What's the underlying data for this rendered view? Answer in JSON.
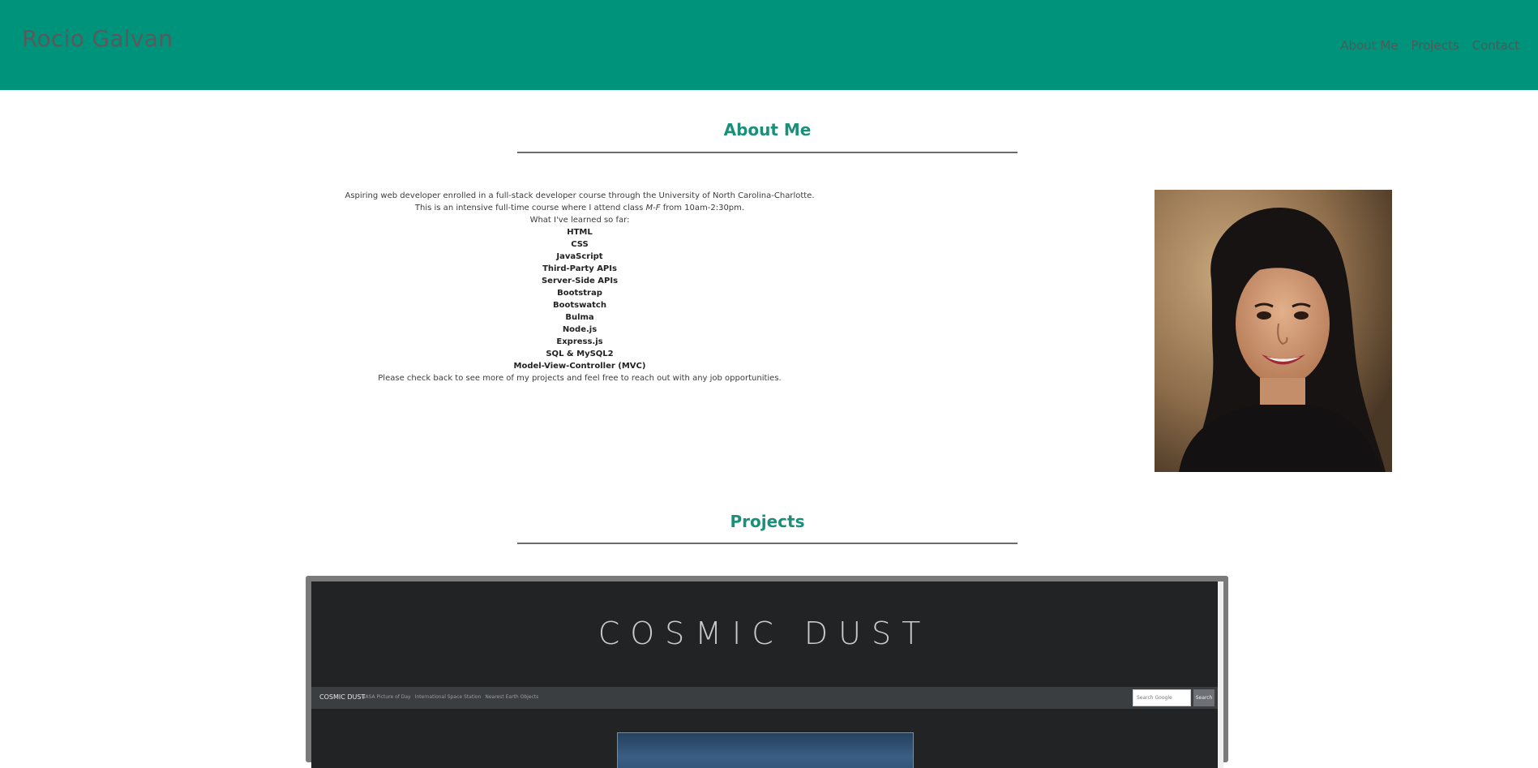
{
  "header": {
    "site_title": "Rocio Galvan",
    "nav": [
      "About Me",
      "Projects",
      "Contact"
    ]
  },
  "about": {
    "heading": "About Me",
    "intro_1": "Aspiring web developer enrolled in a full-stack developer course through the University of North Carolina-Charlotte.",
    "intro_2_prefix": "This is an intensive full-time course where I attend class ",
    "intro_2_em": "M-F",
    "intro_2_suffix": " from 10am-2:30pm.",
    "learned_label": "What I've learned so far:",
    "skills": [
      "HTML",
      "CSS",
      "JavaScript",
      "Third-Party APIs",
      "Server-Side APIs",
      "Bootstrap",
      "Bootswatch",
      "Bulma",
      "Node.js",
      "Express.js",
      "SQL & MySQL2",
      "Model-View-Controller (MVC)"
    ],
    "closing": "Please check back to see more of my projects and feel free to reach out with any job opportunities."
  },
  "projects": {
    "heading": "Projects",
    "preview": {
      "title": "COSMIC DUST",
      "brand": "COSMIC DUST",
      "links": [
        "NASA Picture of Day",
        "International Space Station",
        "Nearest Earth Objects"
      ],
      "search_placeholder": "Search Google",
      "search_button": "Search"
    }
  },
  "colors": {
    "header_bg": "#00937c",
    "heading_accent": "#1a8f7a"
  },
  "icons": {
    "portrait": "profile-photo"
  }
}
